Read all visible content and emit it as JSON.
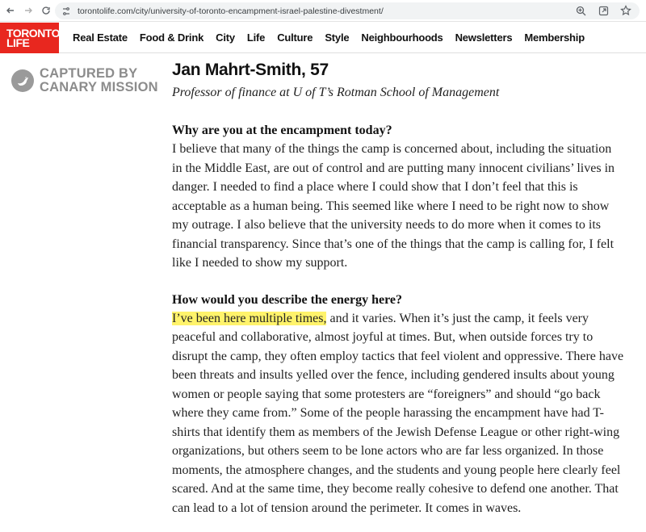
{
  "browser": {
    "url": "torontolife.com/city/university-of-toronto-encampment-israel-palestine-divestment/",
    "icons": [
      "back-arrow-icon",
      "forward-arrow-icon",
      "reload-icon",
      "site-settings-icon",
      "zoom-icon",
      "share-icon",
      "bookmark-star-icon"
    ]
  },
  "site": {
    "logo_line1": "TORONTO",
    "logo_line2": "LIFE",
    "logo_color": "#e8271f",
    "nav": [
      "Real Estate",
      "Food & Drink",
      "City",
      "Life",
      "Culture",
      "Style",
      "Neighbourhoods",
      "Newsletters",
      "Membership"
    ]
  },
  "watermark": {
    "line1": "CAPTURED BY",
    "line2": "CANARY MISSION",
    "color": "#8c8c8c"
  },
  "article": {
    "author_name": "Jan Mahrt-Smith, 57",
    "author_role": "Professor of finance at U of T’s Rotman School of Management",
    "q1": "Why are you at the encampment today?",
    "a1": "I believe that many of the things the camp is concerned about, including the situation in the Middle East, are out of control and are putting many innocent civilians’ lives in danger. I needed to find a place where I could show that I don’t feel that this is acceptable as a human being. This seemed like where I need to be right now to show my outrage. I also believe that the university needs to do more when it comes to its financial transparency. Since that’s one of the things that the camp is calling for, I felt like I needed to show my support.",
    "q2": "How would you describe the energy here?",
    "a2_highlight": "I’ve been here multiple times,",
    "a2_rest": " and it varies. When it’s just the camp, it feels very peaceful and collaborative, almost joyful at times. But, when outside forces try to disrupt the camp, they often employ tactics that feel violent and oppressive. There have been threats and insults yelled over the fence, including gendered insults about young women or people saying that some protesters are “foreigners” and should “go back where they came from.” Some of the people harassing the encampment have had T-shirts that identify them as members of the Jewish Defense League or other right-wing organizations, but others seem to be lone actors who are far less organized. In those moments, the atmosphere changes, and the students and young people here clearly feel scared. And at the same time, they become really cohesive to defend one another. That can lead to a lot of tension around the perimeter. It comes in waves.",
    "highlight_color": "#fff36b"
  }
}
